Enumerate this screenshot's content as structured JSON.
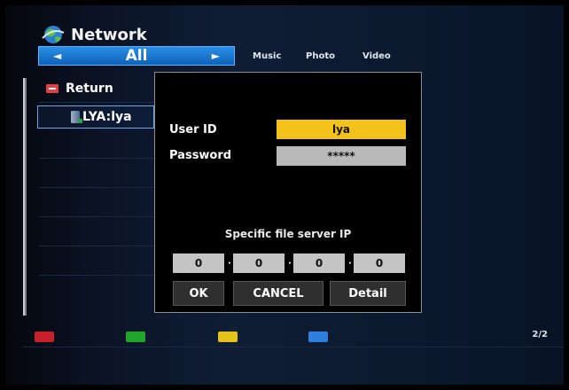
{
  "header": {
    "title": "Network",
    "icon": "network-globe-icon"
  },
  "category_bar": {
    "left_arrow": "◄",
    "label": "All",
    "right_arrow": "►"
  },
  "category_tabs": [
    "Music",
    "Photo",
    "Video"
  ],
  "file_list": {
    "return_label": "Return",
    "server_label": "LYA:lya"
  },
  "dialog": {
    "user_id_label": "User ID",
    "user_id_value": "lya",
    "password_label": "Password",
    "password_value": "*****",
    "ip_caption": "Specific file server IP",
    "ip_octets": [
      "0",
      "0",
      "0",
      "0"
    ],
    "ip_separator": "·",
    "ok_label": "OK",
    "cancel_label": "CANCEL",
    "detail_label": "Detail"
  },
  "footer": {
    "color_keys": [
      {
        "name": "red",
        "color": "#c8202a"
      },
      {
        "name": "green",
        "color": "#21a52b"
      },
      {
        "name": "yellow",
        "color": "#e3c21a"
      },
      {
        "name": "blue",
        "color": "#2f7fe0"
      }
    ],
    "page_indicator": "2/2"
  },
  "colors": {
    "accent_blue": "#1a7ad6",
    "field_highlight": "#f2c21a"
  }
}
